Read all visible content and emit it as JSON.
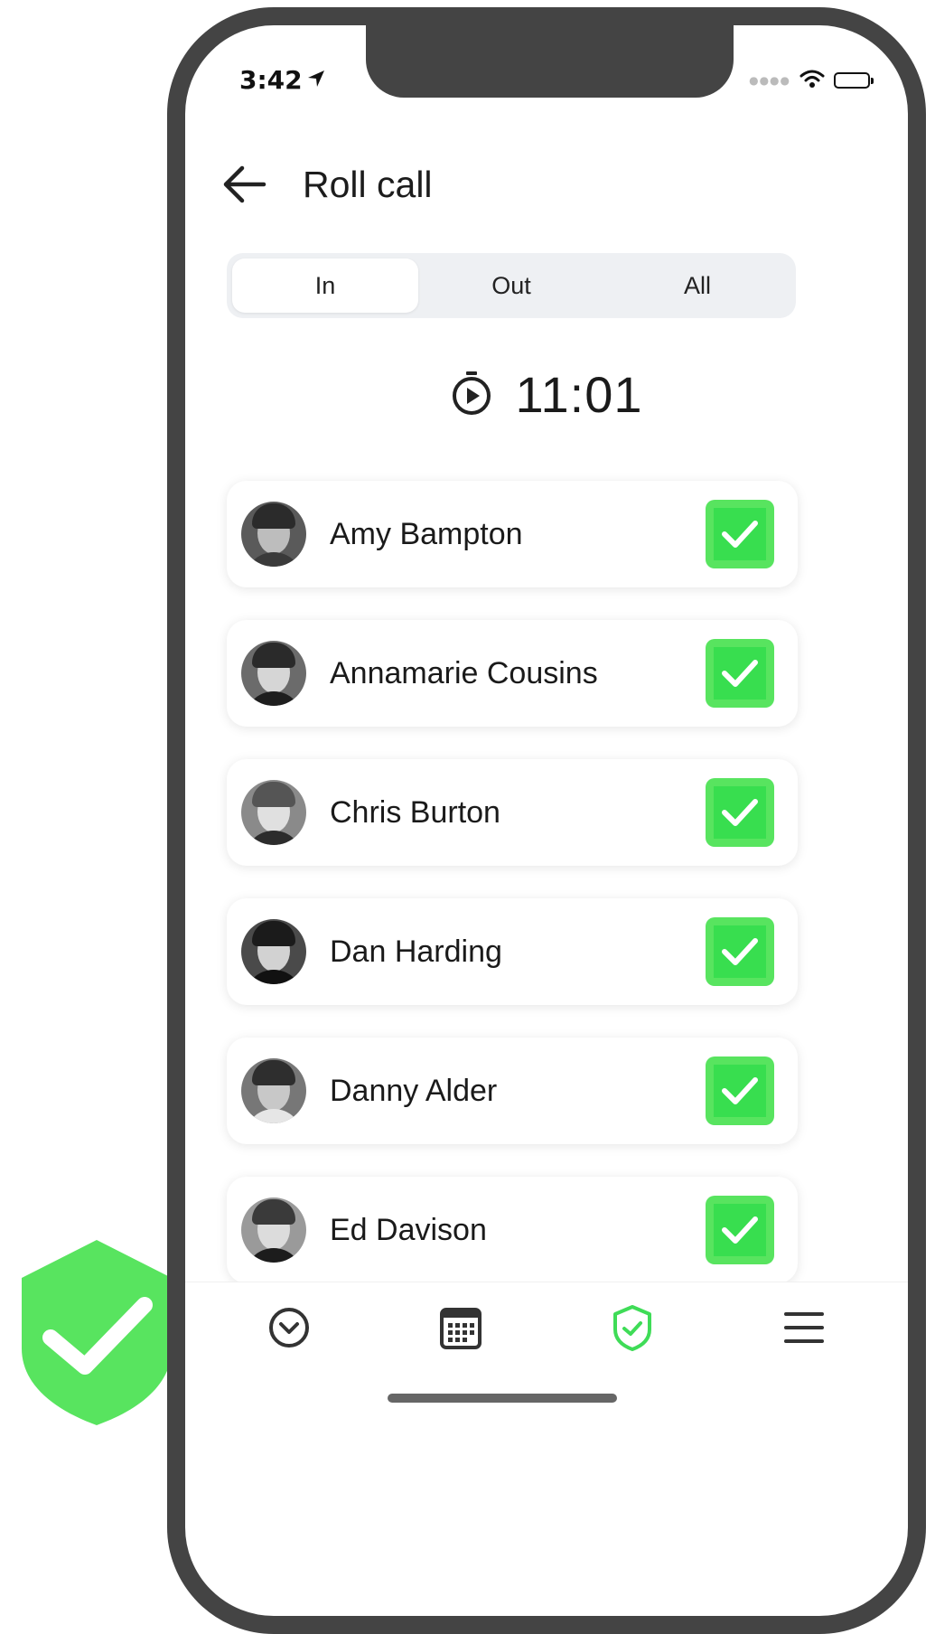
{
  "status_bar": {
    "time": "3:42"
  },
  "header": {
    "title": "Roll call"
  },
  "tabs": [
    {
      "label": "In",
      "active": true
    },
    {
      "label": "Out",
      "active": false
    },
    {
      "label": "All",
      "active": false
    }
  ],
  "timer": {
    "value": "11:01"
  },
  "people": [
    {
      "name": "Amy Bampton",
      "checked": true
    },
    {
      "name": "Annamarie Cousins",
      "checked": true
    },
    {
      "name": "Chris Burton",
      "checked": true
    },
    {
      "name": "Dan Harding",
      "checked": true
    },
    {
      "name": "Danny Alder",
      "checked": true
    },
    {
      "name": "Ed Davison",
      "checked": true
    }
  ],
  "bottom_nav": [
    {
      "icon": "chevron-circle-icon",
      "active": false
    },
    {
      "icon": "calendar-icon",
      "active": false
    },
    {
      "icon": "shield-check-icon",
      "active": true
    },
    {
      "icon": "menu-icon",
      "active": false
    }
  ],
  "colors": {
    "accent_green": "#58e45f",
    "phone_frame": "#444444",
    "text_dark": "#1a1a1a",
    "segment_bg": "#eef0f3"
  }
}
